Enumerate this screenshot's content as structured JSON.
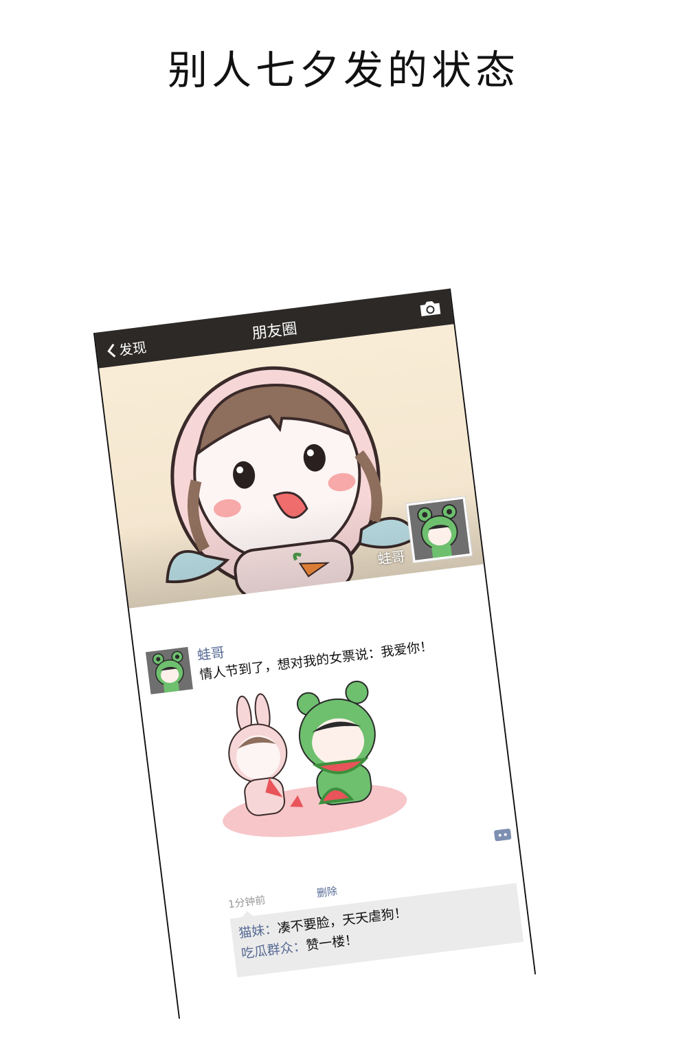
{
  "page": {
    "title": "别人七夕发的状态"
  },
  "navbar": {
    "back_label": "发现",
    "title": "朋友圈"
  },
  "cover": {
    "owner_name": "蛙哥"
  },
  "post": {
    "author": "蛙哥",
    "text": "情人节到了，想对我的女票说：我爱你！",
    "time": "1分钟前",
    "delete_label": "删除"
  },
  "comments": [
    {
      "name": "猫妹：",
      "text": "凑不要脸，天天虐狗！"
    },
    {
      "name": "吃瓜群众：",
      "text": "赞一楼！"
    }
  ],
  "colors": {
    "nav_bg": "#2c2927",
    "link": "#576b95",
    "comment_bg": "#ebebeb"
  }
}
